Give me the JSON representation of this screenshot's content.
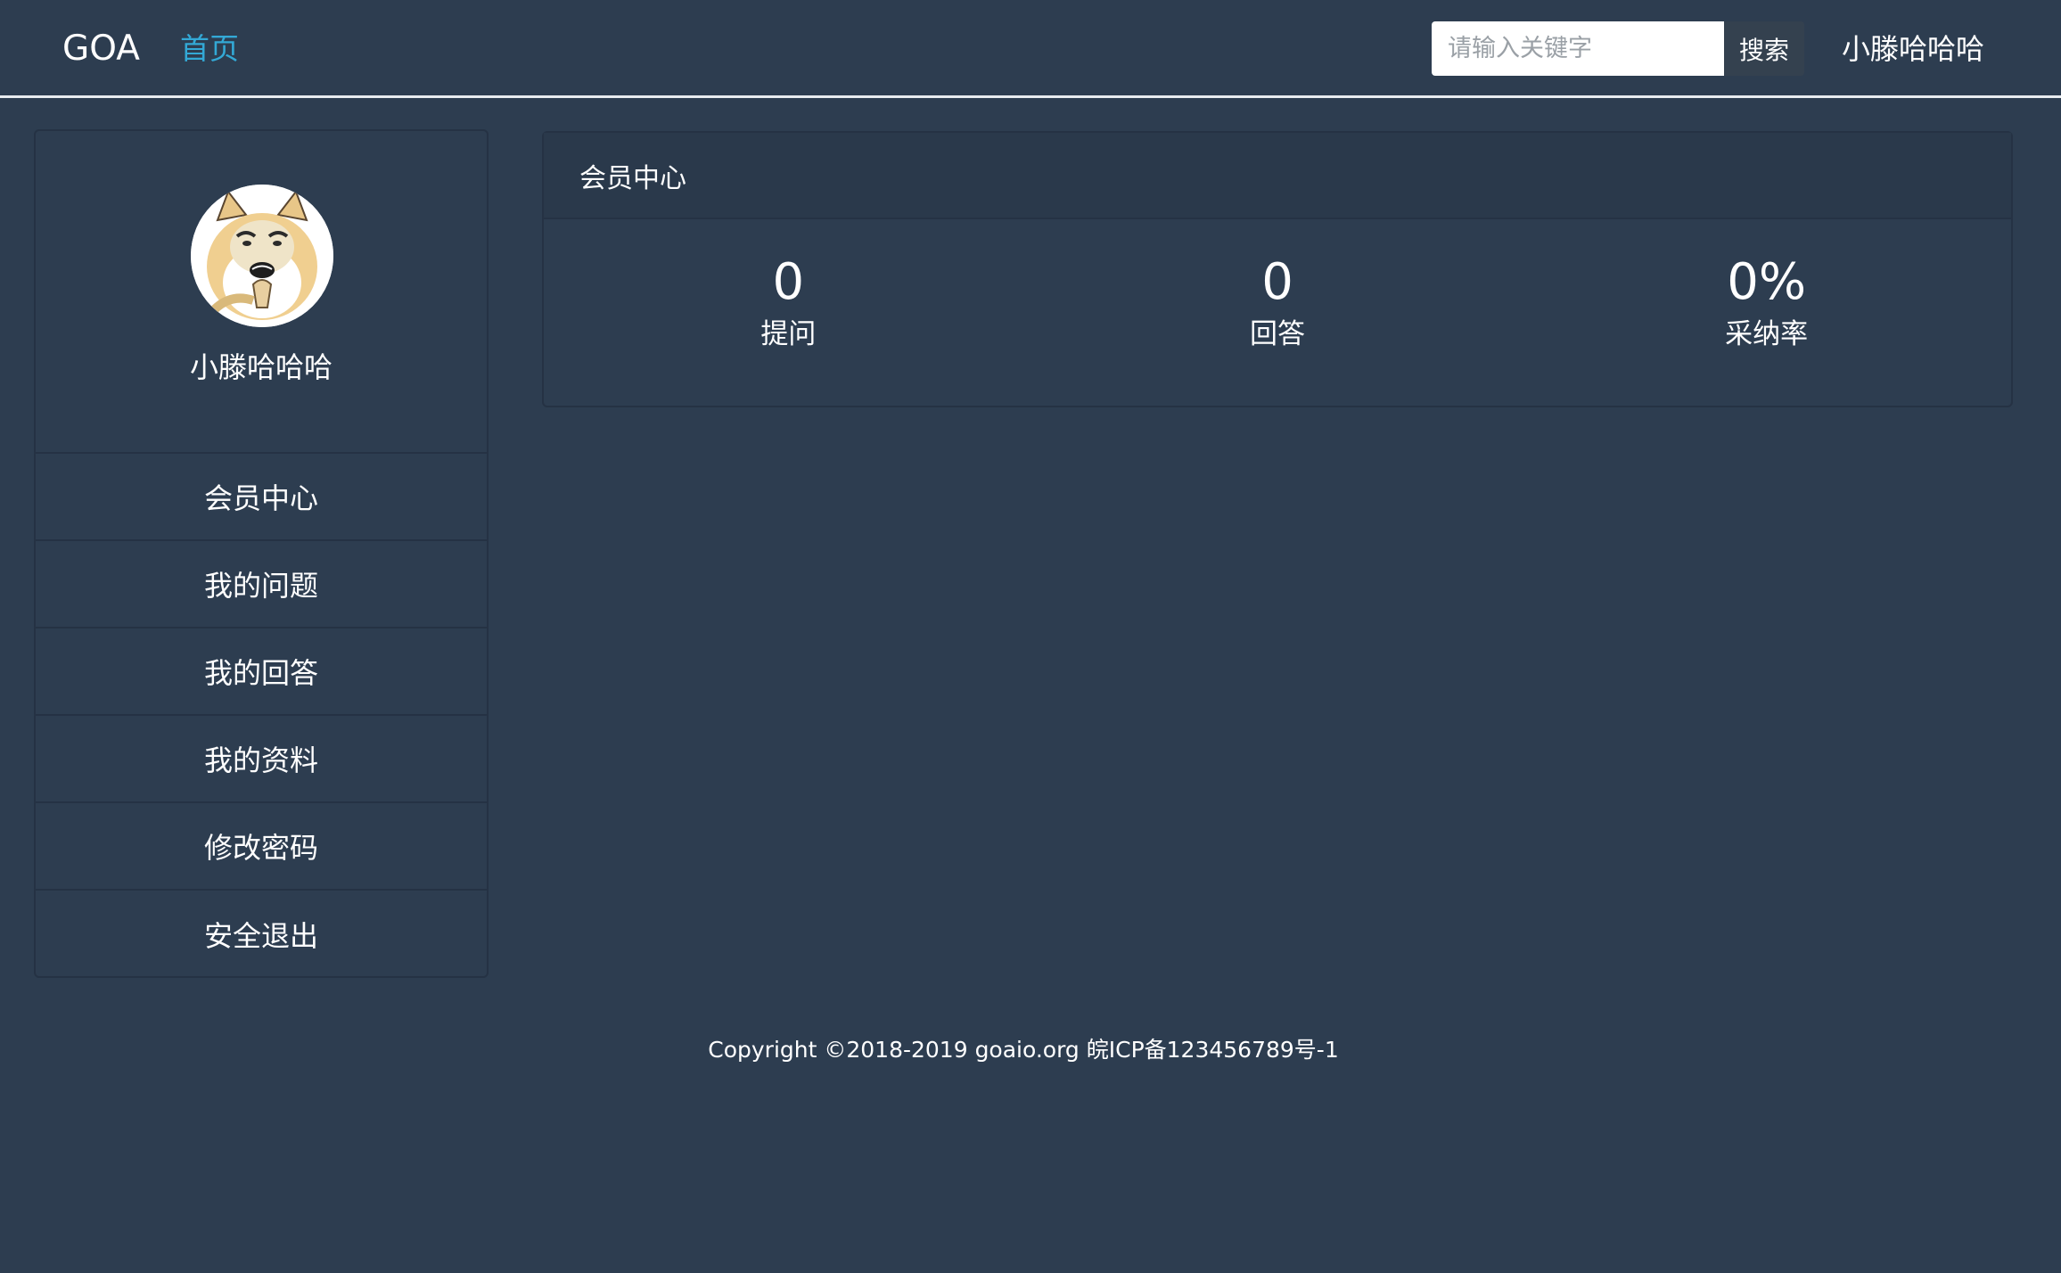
{
  "navbar": {
    "brand": "GOA",
    "home_link": "首页",
    "search_placeholder": "请输入关键字",
    "search_button": "搜索",
    "username": "小滕哈哈哈"
  },
  "sidebar": {
    "profile_name": "小滕哈哈哈",
    "items": [
      {
        "label": "会员中心"
      },
      {
        "label": "我的问题"
      },
      {
        "label": "我的回答"
      },
      {
        "label": "我的资料"
      },
      {
        "label": "修改密码"
      },
      {
        "label": "安全退出"
      }
    ]
  },
  "panel": {
    "title": "会员中心",
    "stats": [
      {
        "value": "0",
        "label": "提问"
      },
      {
        "value": "0",
        "label": "回答"
      },
      {
        "value": "0%",
        "label": "采纳率"
      }
    ]
  },
  "footer": {
    "copyright": "Copyright ©2018-2019 goaio.org 皖ICP备123456789号-1"
  },
  "colors": {
    "background": "#2d3d50",
    "link_accent": "#33a9d6",
    "search_button_bg": "#34414f"
  }
}
